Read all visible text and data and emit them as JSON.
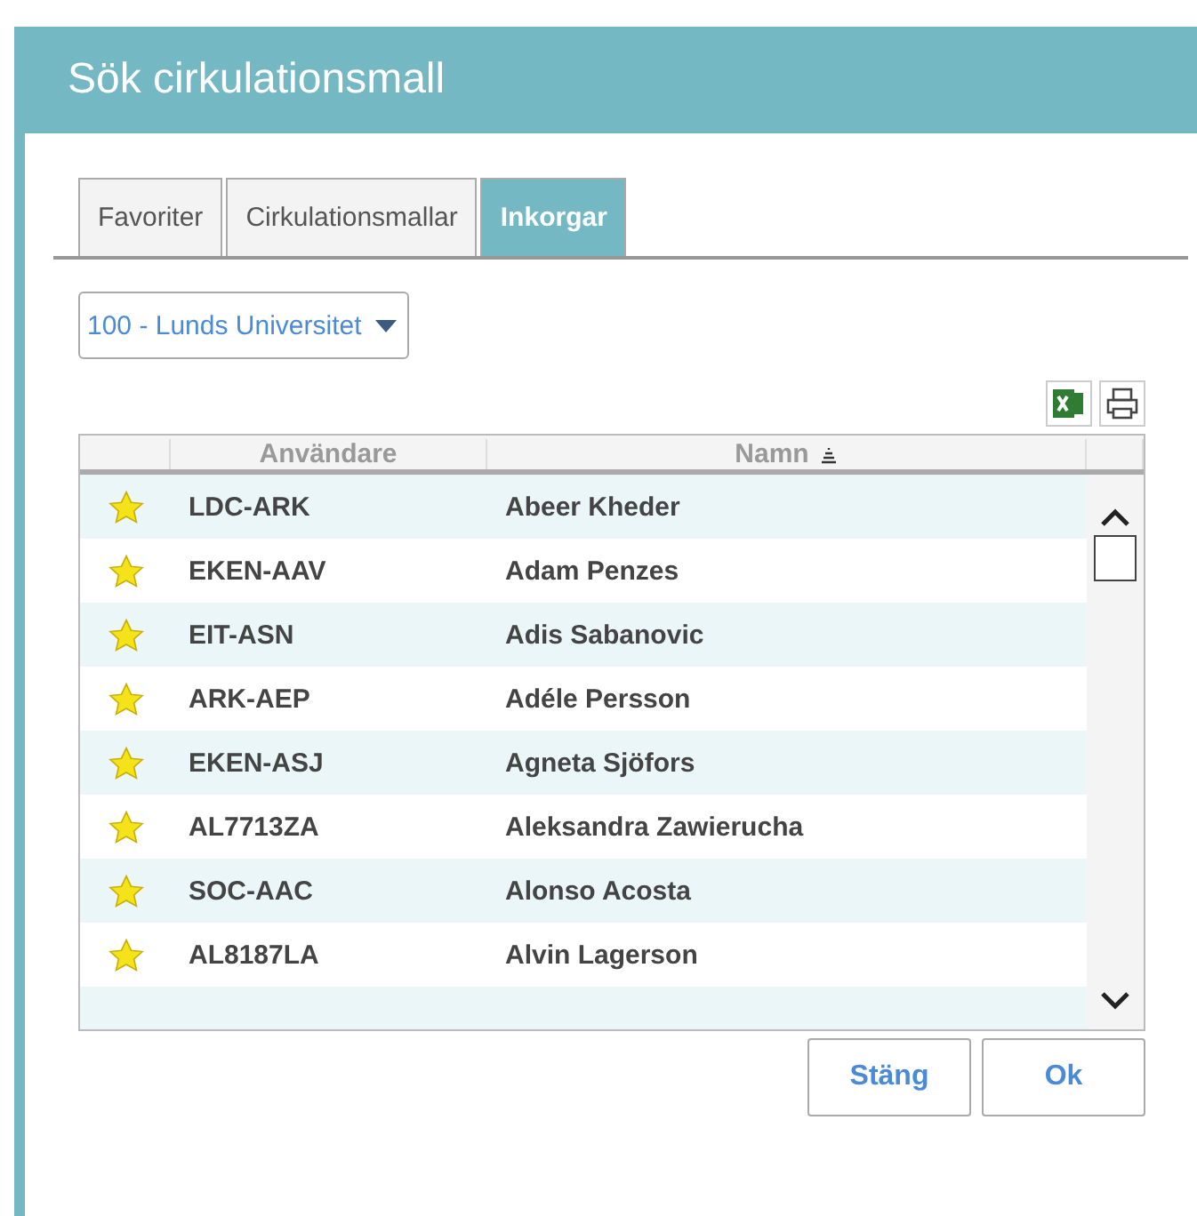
{
  "dialog": {
    "title": "Sök cirkulationsmall"
  },
  "tabs": [
    {
      "label": "Favoriter",
      "selected": false
    },
    {
      "label": "Cirkulationsmallar",
      "selected": false
    },
    {
      "label": "Inkorgar",
      "selected": true
    }
  ],
  "organization_select": {
    "value": "100 - Lunds Universitet"
  },
  "table": {
    "columns": [
      {
        "label": "Användare",
        "sorted": false
      },
      {
        "label": "Namn",
        "sorted": true
      }
    ],
    "rows": [
      {
        "starred": true,
        "user": "LDC-ARK",
        "name": "Abeer Kheder"
      },
      {
        "starred": true,
        "user": "EKEN-AAV",
        "name": "Adam Penzes"
      },
      {
        "starred": true,
        "user": "EIT-ASN",
        "name": "Adis Sabanovic"
      },
      {
        "starred": true,
        "user": "ARK-AEP",
        "name": "Adéle Persson"
      },
      {
        "starred": true,
        "user": "EKEN-ASJ",
        "name": "Agneta Sjöfors"
      },
      {
        "starred": true,
        "user": "AL7713ZA",
        "name": "Aleksandra Zawierucha"
      },
      {
        "starred": true,
        "user": "SOC-AAC",
        "name": "Alonso Acosta"
      },
      {
        "starred": true,
        "user": "AL8187LA",
        "name": "Alvin Lagerson"
      }
    ]
  },
  "buttons": [
    {
      "label": "Stäng"
    },
    {
      "label": "Ok"
    }
  ]
}
